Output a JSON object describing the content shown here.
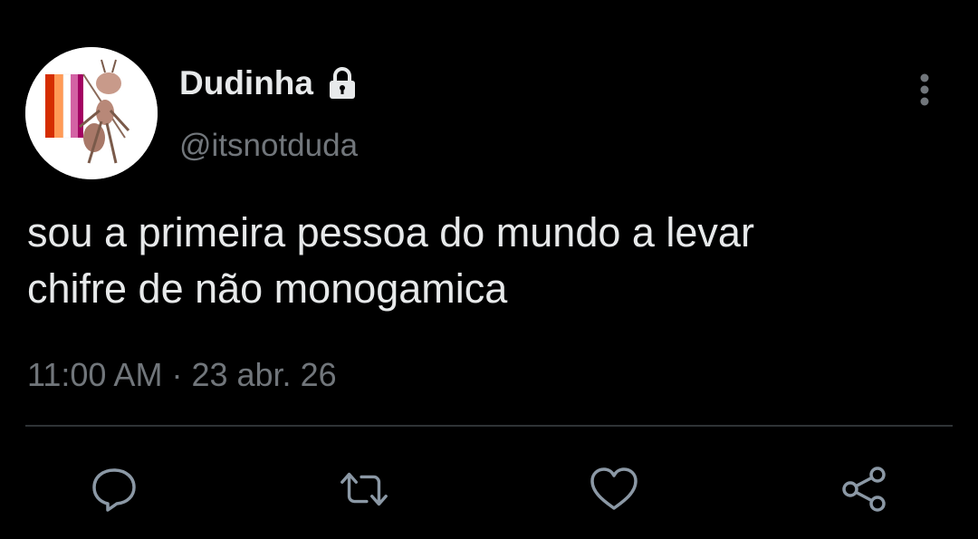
{
  "tweet": {
    "display_name": "Dudinha",
    "handle": "@itsnotduda",
    "text_lines": [
      "sou a primeira pessoa do mundo a levar",
      "chifre de não monogamica"
    ],
    "time": "11:00 AM",
    "separator": "·",
    "date": "23 abr. 26"
  },
  "icons": {
    "avatar": "avatar-ant-with-flag",
    "verified_lock": "lock-icon",
    "more": "more-vertical-icon",
    "reply": "reply-icon",
    "retweet": "retweet-icon",
    "like": "heart-icon",
    "share": "share-icon"
  },
  "colors": {
    "background": "#000000",
    "primary_text": "#e7e9ea",
    "secondary_text": "#71767b",
    "divider": "#2f3336",
    "action_icon": "#8b98a5"
  }
}
